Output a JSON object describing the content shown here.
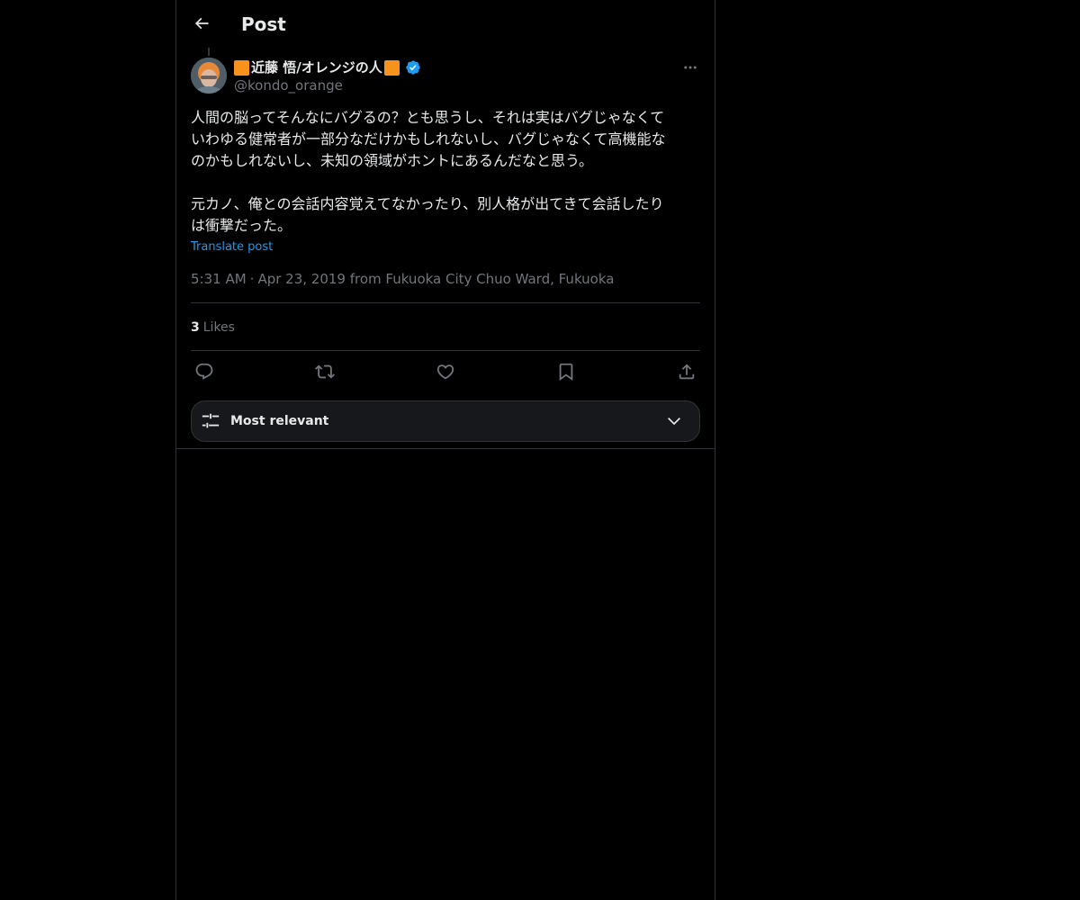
{
  "header": {
    "title": "Post",
    "back_icon": "arrow-left-icon"
  },
  "post": {
    "author": {
      "display_name": "近藤 悟/オレンジの人",
      "handle": "@kondo_orange",
      "verified": true,
      "name_decoration_color": "#f7931a",
      "verified_color": "#1d9bf0"
    },
    "text": "人間の脳ってそんなにバグるの？とも思うし、それは実はバグじゃなくて\nいわゆる健常者が一部分なだけかもしれないし、バグじゃなくて高機能な\nのかもしれないし、未知の領域がホントにあるんだなと思う。\n\n元カノ、俺との会話内容覚えてなかったり、別人格が出てきて会話したり\nは衝撃だった。",
    "translate_label": "Translate post",
    "time": "5:31 AM",
    "separator": "·",
    "date_location": "Apr 23, 2019 from Fukuoka City Chuo Ward, Fukuoka",
    "likes_count": "3",
    "likes_label": "Likes"
  },
  "actions": {
    "reply_icon": "reply-icon",
    "repost_icon": "repost-icon",
    "like_icon": "heart-icon",
    "bookmark_icon": "bookmark-icon",
    "share_icon": "share-icon"
  },
  "sort": {
    "label": "Most relevant",
    "icon": "sliders-icon",
    "dropdown_icon": "chevron-down-icon"
  },
  "colors": {
    "background": "#000000",
    "text_primary": "#e7e9ea",
    "text_secondary": "#71767b",
    "accent": "#1d9bf0",
    "border": "#2f3336"
  }
}
